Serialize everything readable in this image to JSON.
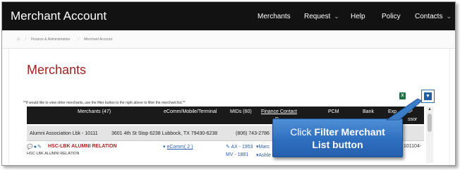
{
  "app": {
    "title": "Merchant Account"
  },
  "nav": {
    "items": [
      {
        "label": "Merchants",
        "has_dropdown": false
      },
      {
        "label": "Request",
        "has_dropdown": true
      },
      {
        "label": "Help",
        "has_dropdown": false
      },
      {
        "label": "Policy",
        "has_dropdown": false
      },
      {
        "label": "Contacts",
        "has_dropdown": true
      }
    ]
  },
  "breadcrumb": {
    "home_icon": "home-icon",
    "items": [
      "Finance & Administration",
      "Merchant Account"
    ]
  },
  "page": {
    "title": "Merchants",
    "hint": "**If would like to view other merchants, use the filter button to the right above to filter the merchant list.**"
  },
  "toolbar": {
    "excel_icon": "excel-export-icon",
    "excel_glyph": "X",
    "filter_icon": "filter-icon"
  },
  "table": {
    "headers": [
      {
        "label": "Merchants (47)"
      },
      {
        "label": "eComm/Mobile/Terminal"
      },
      {
        "label": "MIDs (60)"
      },
      {
        "label": "Finance Contact",
        "sub": "D"
      },
      {
        "label": "PCM"
      },
      {
        "label": "Bank"
      },
      {
        "label": "Exp",
        "sub": ""
      },
      {
        "label": "OAP",
        "sub": "ssor"
      }
    ],
    "group": {
      "name": "Alumni Association Lbk - 10111",
      "address": "3601 4th St Stop 6238 Lubbock, TX 79430-6238",
      "phone": "(806) 743-2786"
    },
    "rows": [
      {
        "icons": [
          "comment-icon",
          "users-icon",
          "edit-icon"
        ],
        "merchant": "HSC-LBK ALUMNI RELATION",
        "merchant_sub": "HSC-LBK ALUMNI RELATION",
        "ecomm_prefix": "▾",
        "ecomm_link": "eComm",
        "ecomm_count": "( 2 )",
        "mid_line1": "AX - 1953",
        "mid_line2": "MV - 1881",
        "finance_line1": "▾Marc",
        "finance_line2": "▾Ashle",
        "tail": "101104-"
      }
    ]
  },
  "callout": {
    "prefix": "Click ",
    "bold": "Filter Merchant",
    "line2": "List button"
  },
  "colors": {
    "topbar": "#121212",
    "title_red": "#a42121",
    "callout_blue": "#2f6fc0",
    "filter_blue": "#1f5fa6"
  }
}
